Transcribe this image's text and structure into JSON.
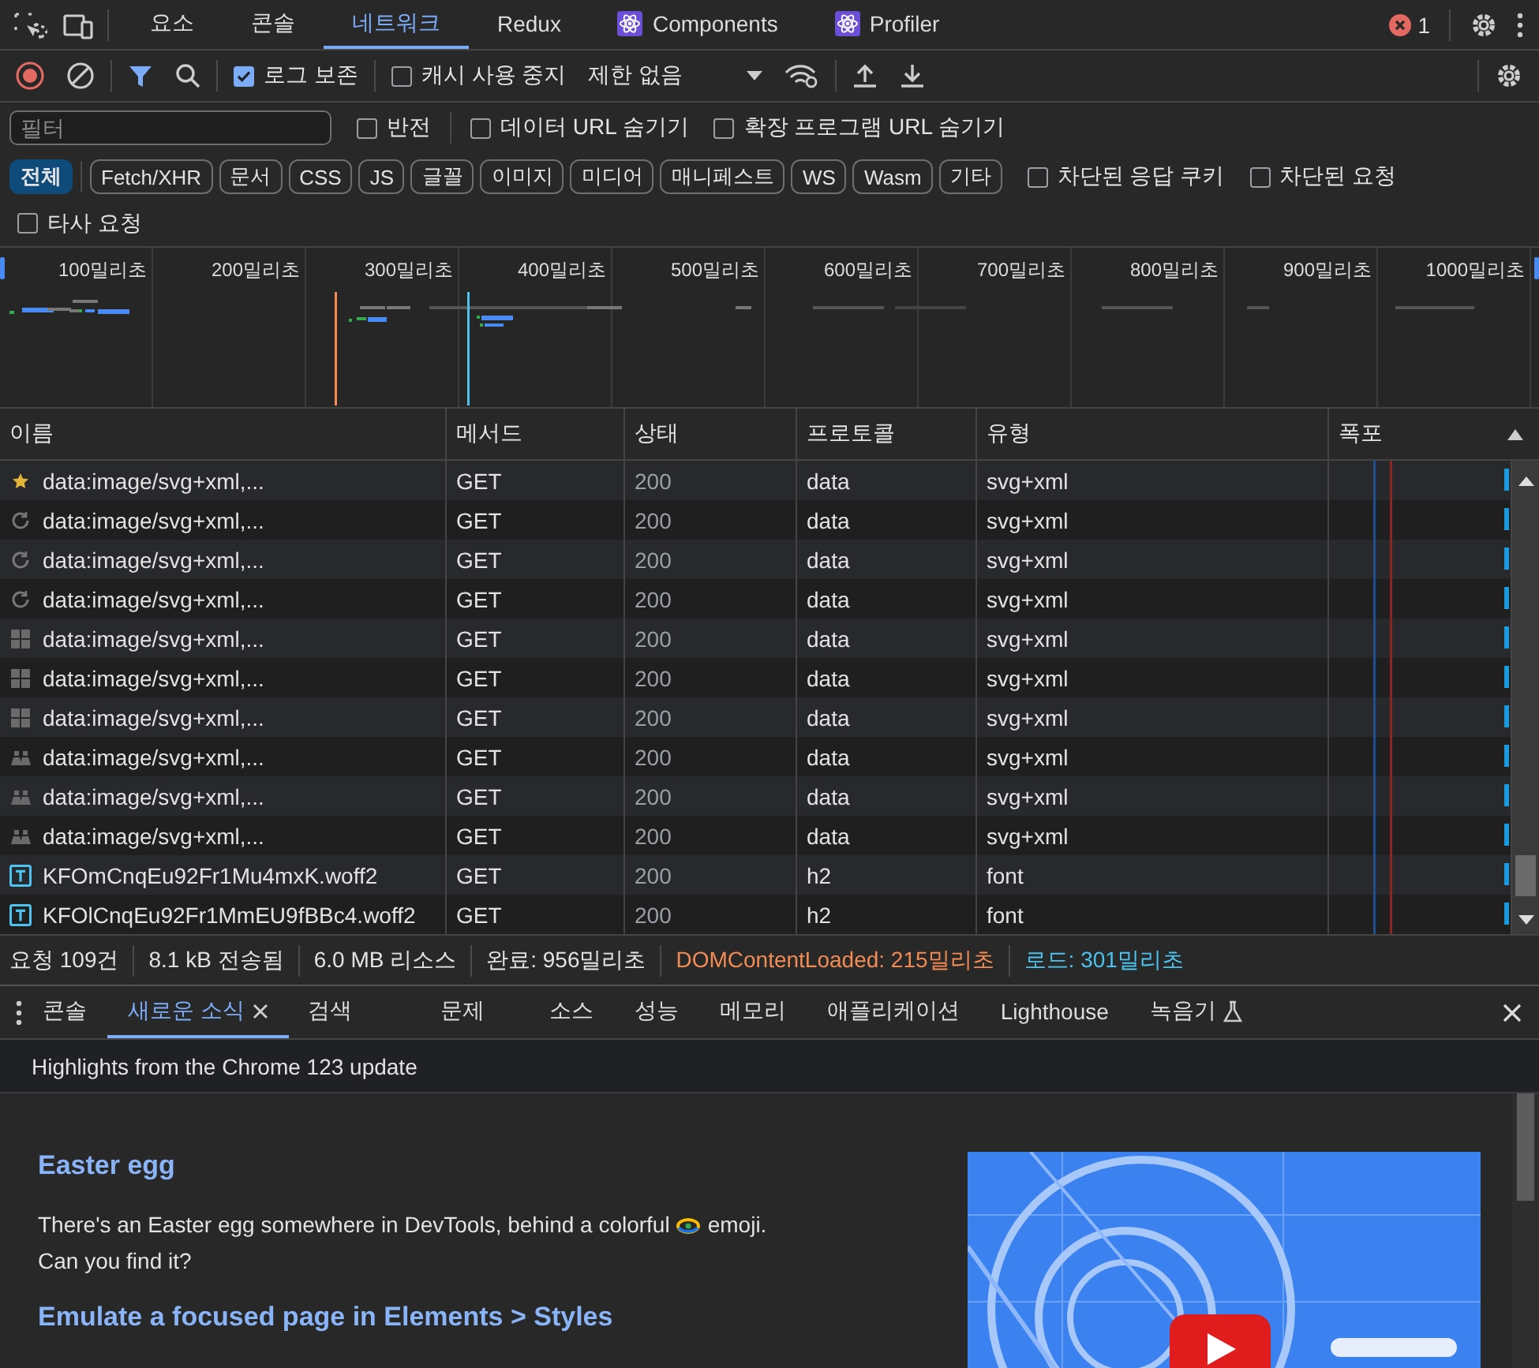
{
  "panel_tabs": [
    {
      "label": "요소",
      "selected": false,
      "kind": "plain"
    },
    {
      "label": "콘솔",
      "selected": false,
      "kind": "plain"
    },
    {
      "label": "네트워크",
      "selected": true,
      "kind": "plain"
    },
    {
      "label": "Redux",
      "selected": false,
      "kind": "plain"
    },
    {
      "label": "Components",
      "selected": false,
      "kind": "react"
    },
    {
      "label": "Profiler",
      "selected": false,
      "kind": "react"
    }
  ],
  "error_count": "1",
  "toolbar": {
    "preserve_log": {
      "label": "로그 보존",
      "checked": true
    },
    "disable_cache": {
      "label": "캐시 사용 중지",
      "checked": false
    },
    "throttling": "제한 없음"
  },
  "filter": {
    "placeholder": "필터",
    "options": [
      {
        "label": "반전",
        "checked": false
      },
      {
        "label": "데이터 URL 숨기기",
        "checked": false
      },
      {
        "label": "확장 프로그램 URL 숨기기",
        "checked": false
      }
    ]
  },
  "type_filters": [
    {
      "label": "전체",
      "selected": true
    },
    {
      "label": "Fetch/XHR",
      "selected": false
    },
    {
      "label": "문서",
      "selected": false
    },
    {
      "label": "CSS",
      "selected": false
    },
    {
      "label": "JS",
      "selected": false
    },
    {
      "label": "글꼴",
      "selected": false
    },
    {
      "label": "이미지",
      "selected": false
    },
    {
      "label": "미디어",
      "selected": false
    },
    {
      "label": "매니페스트",
      "selected": false
    },
    {
      "label": "WS",
      "selected": false
    },
    {
      "label": "Wasm",
      "selected": false
    },
    {
      "label": "기타",
      "selected": false
    }
  ],
  "extra_filters": [
    {
      "label": "차단된 응답 쿠키",
      "checked": false
    },
    {
      "label": "차단된 요청",
      "checked": false
    },
    {
      "label": "타사 요청",
      "checked": false
    }
  ],
  "overview": {
    "ticks": [
      "100밀리초",
      "200밀리초",
      "300밀리초",
      "400밀리초",
      "500밀리초",
      "600밀리초",
      "700밀리초",
      "800밀리초",
      "900밀리초",
      "1000밀리초"
    ]
  },
  "table": {
    "columns": [
      "이름",
      "메서드",
      "상태",
      "프로토콜",
      "유형",
      "폭포"
    ],
    "rows": [
      {
        "kind": "star",
        "name": "data:image/svg+xml,...",
        "method": "GET",
        "status": "200",
        "protocol": "data",
        "type": "svg+xml"
      },
      {
        "kind": "spinner",
        "name": "data:image/svg+xml,...",
        "method": "GET",
        "status": "200",
        "protocol": "data",
        "type": "svg+xml"
      },
      {
        "kind": "spinner",
        "name": "data:image/svg+xml,...",
        "method": "GET",
        "status": "200",
        "protocol": "data",
        "type": "svg+xml"
      },
      {
        "kind": "spinner",
        "name": "data:image/svg+xml,...",
        "method": "GET",
        "status": "200",
        "protocol": "data",
        "type": "svg+xml"
      },
      {
        "kind": "grid",
        "name": "data:image/svg+xml,...",
        "method": "GET",
        "status": "200",
        "protocol": "data",
        "type": "svg+xml"
      },
      {
        "kind": "grid",
        "name": "data:image/svg+xml,...",
        "method": "GET",
        "status": "200",
        "protocol": "data",
        "type": "svg+xml"
      },
      {
        "kind": "grid",
        "name": "data:image/svg+xml,...",
        "method": "GET",
        "status": "200",
        "protocol": "data",
        "type": "svg+xml"
      },
      {
        "kind": "group",
        "name": "data:image/svg+xml,...",
        "method": "GET",
        "status": "200",
        "protocol": "data",
        "type": "svg+xml"
      },
      {
        "kind": "group",
        "name": "data:image/svg+xml,...",
        "method": "GET",
        "status": "200",
        "protocol": "data",
        "type": "svg+xml"
      },
      {
        "kind": "group",
        "name": "data:image/svg+xml,...",
        "method": "GET",
        "status": "200",
        "protocol": "data",
        "type": "svg+xml"
      },
      {
        "kind": "font",
        "name": "KFOmCnqEu92Fr1Mu4mxK.woff2",
        "method": "GET",
        "status": "200",
        "protocol": "h2",
        "type": "font"
      },
      {
        "kind": "font",
        "name": "KFOlCnqEu92Fr1MmEU9fBBc4.woff2",
        "method": "GET",
        "status": "200",
        "protocol": "h2",
        "type": "font"
      }
    ]
  },
  "status_bar": [
    {
      "text": "요청 109건"
    },
    {
      "text": "8.1 kB 전송됨"
    },
    {
      "text": "6.0 MB 리소스"
    },
    {
      "text": "완료: 956밀리초"
    },
    {
      "text": "DOMContentLoaded: 215밀리초",
      "color": "#f28b54"
    },
    {
      "text": "로드: 301밀리초",
      "color": "#4cc3f0"
    }
  ],
  "drawer": {
    "tabs": [
      {
        "label": "콘솔",
        "selected": false,
        "closable": false,
        "experimental": false
      },
      {
        "label": "새로운 소식",
        "selected": true,
        "closable": true,
        "experimental": false
      },
      {
        "label": "검색",
        "selected": false,
        "closable": false,
        "experimental": false
      },
      {
        "label": "문제",
        "selected": false,
        "closable": false,
        "experimental": false
      },
      {
        "label": "소스",
        "selected": false,
        "closable": false,
        "experimental": false
      },
      {
        "label": "성능",
        "selected": false,
        "closable": false,
        "experimental": false
      },
      {
        "label": "메모리",
        "selected": false,
        "closable": false,
        "experimental": false
      },
      {
        "label": "애플리케이션",
        "selected": false,
        "closable": false,
        "experimental": false
      },
      {
        "label": "Lighthouse",
        "selected": false,
        "closable": false,
        "experimental": false
      },
      {
        "label": "녹음기",
        "selected": false,
        "closable": false,
        "experimental": true
      }
    ]
  },
  "whats_new": {
    "title": "Highlights from the Chrome 123 update",
    "sections": [
      {
        "heading": "Easter egg",
        "text_before": "There's an Easter egg somewhere in DevTools, behind a colorful",
        "text_after": "emoji.",
        "text_next_line": "Can you find it?"
      },
      {
        "heading": "Emulate a focused page in Elements > Styles"
      }
    ]
  }
}
